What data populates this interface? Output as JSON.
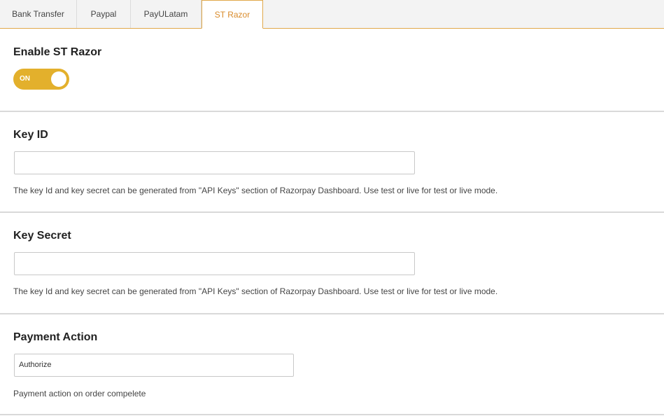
{
  "tabs": [
    {
      "label": "Bank Transfer",
      "active": false
    },
    {
      "label": "Paypal",
      "active": false
    },
    {
      "label": "PayULatam",
      "active": false
    },
    {
      "label": "ST Razor",
      "active": true
    }
  ],
  "enable": {
    "title": "Enable ST Razor",
    "toggle_label": "ON",
    "toggle_state": true
  },
  "key_id": {
    "title": "Key ID",
    "value": "",
    "help": "The key Id and key secret can be generated from \"API Keys\" section of Razorpay Dashboard. Use test or live for test or live mode."
  },
  "key_secret": {
    "title": "Key Secret",
    "value": "",
    "help": "The key Id and key secret can be generated from \"API Keys\" section of Razorpay Dashboard. Use test or live for test or live mode."
  },
  "payment_action": {
    "title": "Payment Action",
    "selected": "Authorize",
    "help": "Payment action on order compelete"
  },
  "colors": {
    "accent": "#e3b02c",
    "active_tab_text": "#d98b2b",
    "active_tab_border": "#e0a84a"
  }
}
